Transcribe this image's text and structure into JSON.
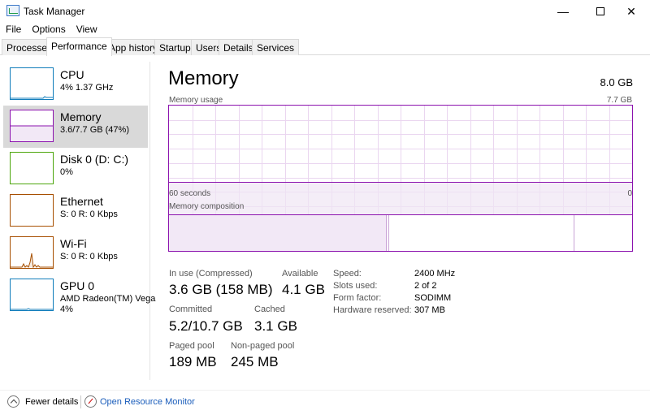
{
  "window": {
    "title": "Task Manager",
    "controls": {
      "minimize": "—",
      "close": "✕"
    }
  },
  "menu": [
    "File",
    "Options",
    "View"
  ],
  "tabs": [
    "Processes",
    "Performance",
    "App history",
    "Startup",
    "Users",
    "Details",
    "Services"
  ],
  "active_tab": "Performance",
  "sidebar": {
    "items": [
      {
        "title": "CPU",
        "subtitle": "4%  1.37 GHz",
        "color": "#117dbb",
        "icon": "cpu-graph-icon"
      },
      {
        "title": "Memory",
        "subtitle": "3.6/7.7 GB (47%)",
        "color": "#8b12ae",
        "icon": "memory-graph-icon"
      },
      {
        "title": "Disk 0 (D: C:)",
        "subtitle": "0%",
        "color": "#4da60c",
        "icon": "disk-graph-icon"
      },
      {
        "title": "Ethernet",
        "subtitle": "S: 0  R: 0 Kbps",
        "color": "#a74f01",
        "icon": "ethernet-graph-icon"
      },
      {
        "title": "Wi-Fi",
        "subtitle": "S: 0  R: 0 Kbps",
        "color": "#a74f01",
        "icon": "wifi-graph-icon"
      },
      {
        "title": "GPU 0",
        "subtitle": "AMD Radeon(TM) Vega",
        "subtitle2": "4%",
        "color": "#117dbb",
        "icon": "gpu-graph-icon"
      }
    ],
    "selected": "Memory"
  },
  "main": {
    "title": "Memory",
    "total": "8.0 GB",
    "usage_graph": {
      "label": "Memory usage",
      "max_label": "7.7 GB",
      "time_label": "60 seconds",
      "zero_label": "0",
      "fill_fraction": 0.47,
      "color": "#8b12ae"
    },
    "composition": {
      "label": "Memory composition",
      "in_use_fraction": 0.47,
      "modified_fraction": 0.005,
      "standby_fraction": 0.4
    },
    "stats": {
      "in_use_label": "In use (Compressed)",
      "in_use_value": "3.6 GB (158 MB)",
      "available_label": "Available",
      "available_value": "4.1 GB",
      "committed_label": "Committed",
      "committed_value": "5.2/10.7 GB",
      "cached_label": "Cached",
      "cached_value": "3.1 GB",
      "paged_label": "Paged pool",
      "paged_value": "189 MB",
      "nonpaged_label": "Non-paged pool",
      "nonpaged_value": "245 MB"
    },
    "info": [
      {
        "key": "Speed:",
        "value": "2400 MHz"
      },
      {
        "key": "Slots used:",
        "value": "2 of 2"
      },
      {
        "key": "Form factor:",
        "value": "SODIMM"
      },
      {
        "key": "Hardware reserved:",
        "value": "307 MB"
      }
    ]
  },
  "footer": {
    "fewer_details": "Fewer details",
    "resource_monitor": "Open Resource Monitor"
  }
}
